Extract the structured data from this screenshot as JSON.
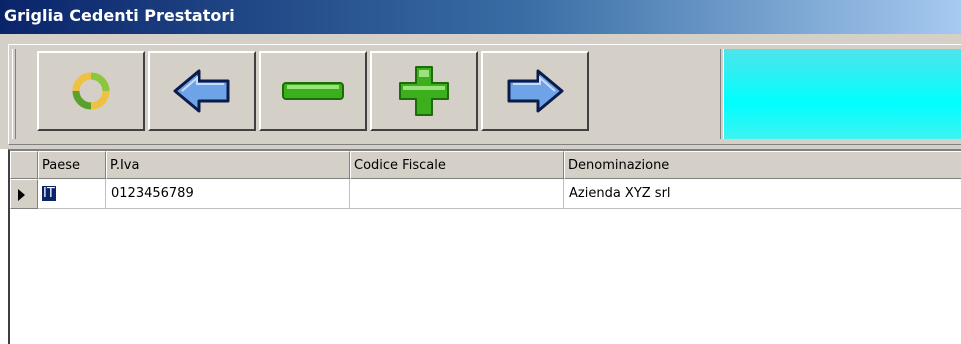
{
  "window": {
    "title": "Griglia Cedenti Prestatori"
  },
  "toolbar": {
    "buttons": [
      {
        "name": "refresh-button",
        "icon": "refresh-icon"
      },
      {
        "name": "previous-button",
        "icon": "arrow-left-icon"
      },
      {
        "name": "delete-button",
        "icon": "minus-icon"
      },
      {
        "name": "add-button",
        "icon": "plus-icon"
      },
      {
        "name": "next-button",
        "icon": "arrow-right-icon"
      }
    ],
    "accent": "#00ffff"
  },
  "grid": {
    "columns": [
      "Paese",
      "P.Iva",
      "Codice Fiscale",
      "Denominazione"
    ],
    "rows": [
      {
        "paese": "IT",
        "piva": "0123456789",
        "codice_fiscale": "",
        "denominazione": "Azienda XYZ srl"
      }
    ],
    "selection_color": "#0a246a"
  }
}
